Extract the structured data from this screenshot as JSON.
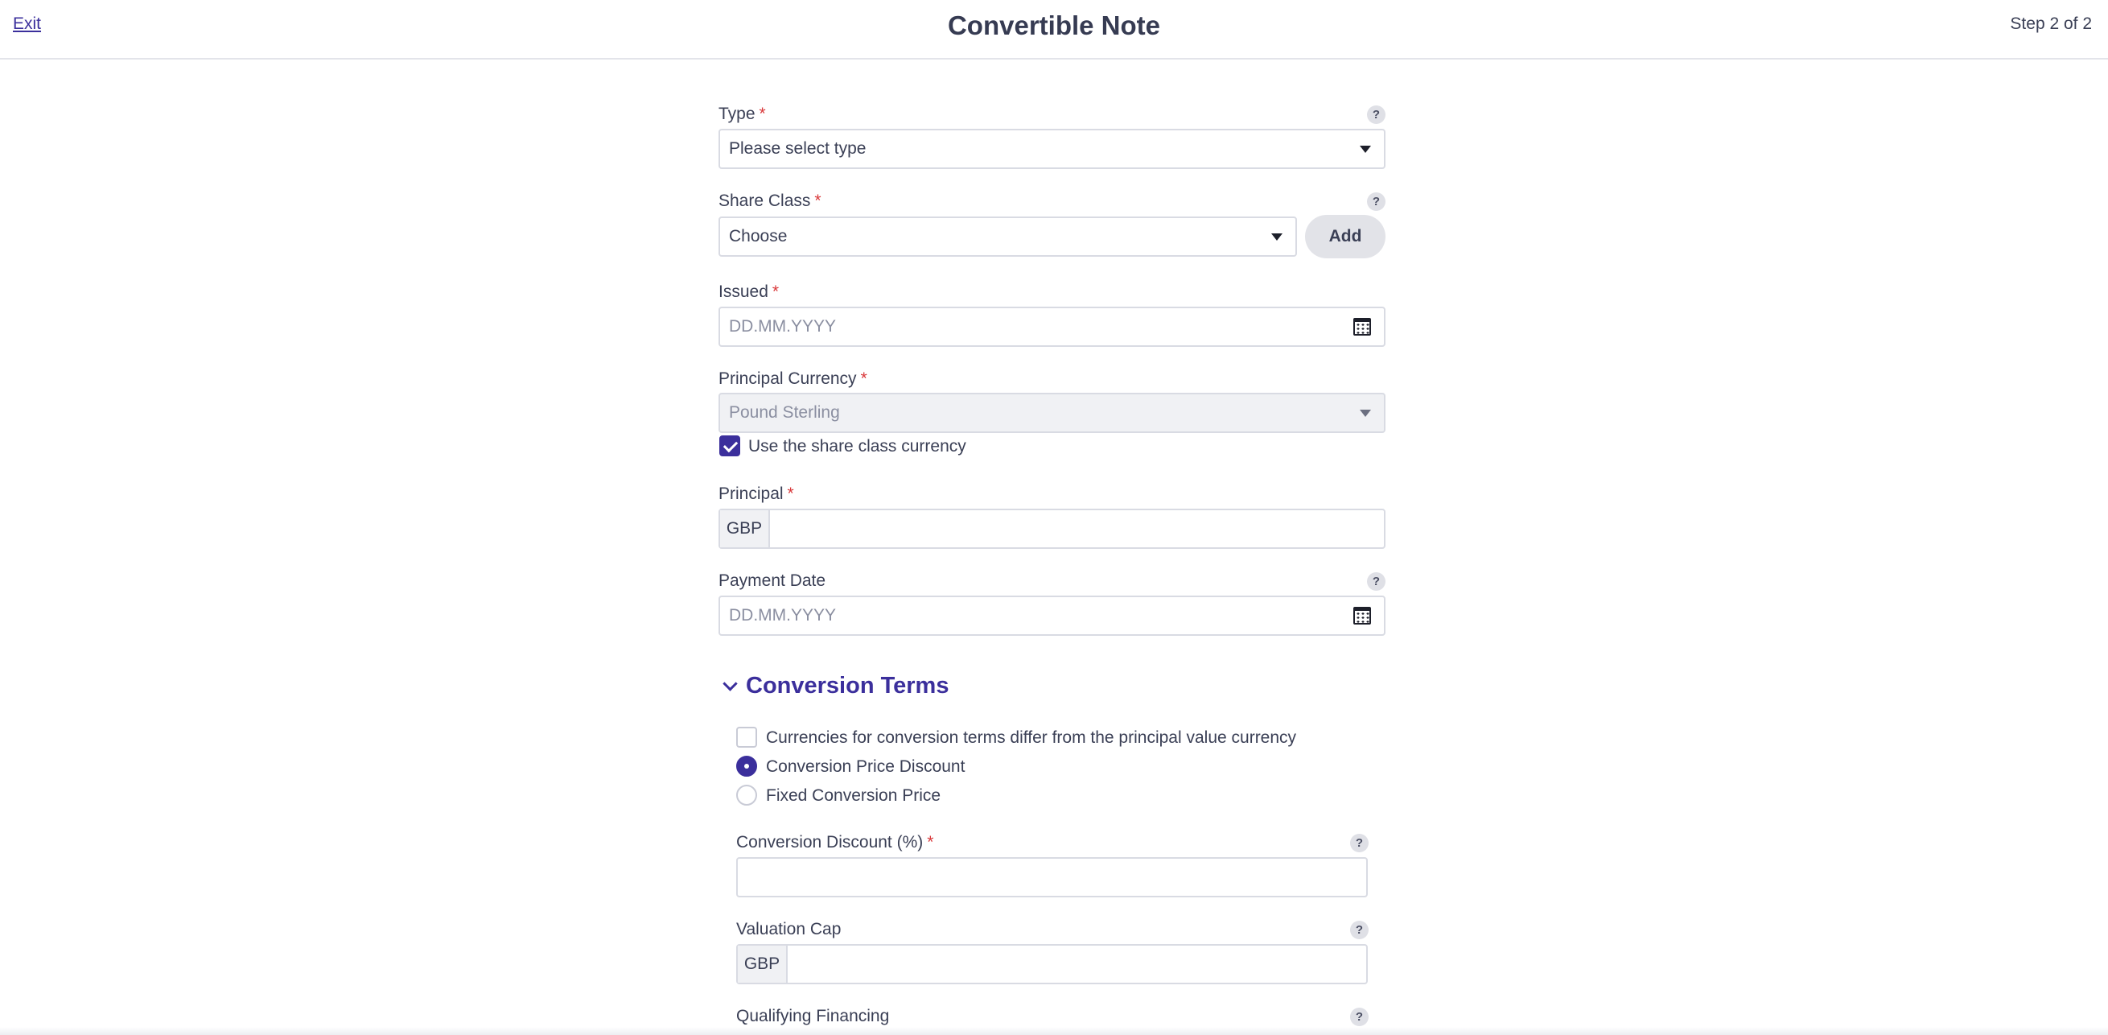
{
  "header": {
    "exit_label": "Exit",
    "title": "Convertible Note",
    "step": "Step 2 of 2"
  },
  "form": {
    "type": {
      "label": "Type",
      "value": "Please select type"
    },
    "share_class": {
      "label": "Share Class",
      "value": "Choose",
      "add_label": "Add"
    },
    "issued": {
      "label": "Issued",
      "placeholder": "DD.MM.YYYY"
    },
    "principal_currency": {
      "label": "Principal Currency",
      "value": "Pound Sterling",
      "checkbox_label": "Use the share class currency",
      "checked": true
    },
    "principal": {
      "label": "Principal",
      "currency": "GBP",
      "value": ""
    },
    "payment_date": {
      "label": "Payment Date",
      "placeholder": "DD.MM.YYYY"
    }
  },
  "conversion_terms": {
    "title": "Conversion Terms",
    "currency_differ_label": "Currencies for conversion terms differ from the principal value currency",
    "currency_differ_checked": false,
    "options": [
      {
        "label": "Conversion Price Discount",
        "selected": true
      },
      {
        "label": "Fixed Conversion Price",
        "selected": false
      }
    ],
    "discount": {
      "label": "Conversion Discount (%)",
      "value": ""
    },
    "valuation_cap": {
      "label": "Valuation Cap",
      "currency": "GBP",
      "value": ""
    },
    "qualifying_financing": {
      "label": "Qualifying Financing"
    }
  },
  "required_mark": "*",
  "help_mark": "?",
  "colors": {
    "accent": "#3b2f9c",
    "required": "#d9393b",
    "border": "#d9dbe3",
    "text": "#3a3f55"
  }
}
